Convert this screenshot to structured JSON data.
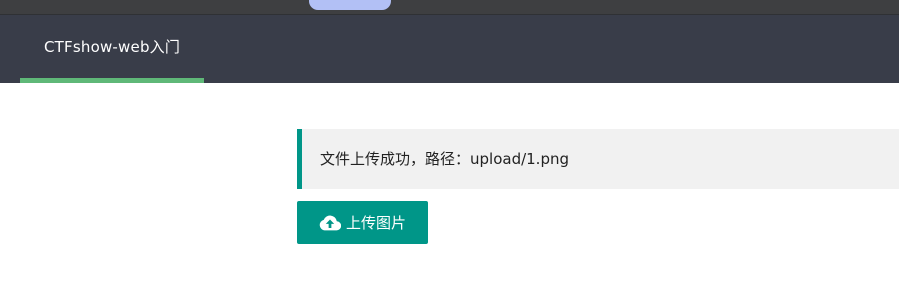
{
  "nav": {
    "tabs": [
      {
        "label": "CTFshow-web入门",
        "active": true
      }
    ]
  },
  "notice": {
    "message": "文件上传成功，路径：upload/1.png"
  },
  "upload": {
    "button_label": "上传图片",
    "icon": "cloud-upload-icon"
  },
  "colors": {
    "nav_bg": "#393d49",
    "active_indicator": "#5fb878",
    "accent": "#009688",
    "notice_bg": "#f1f1f1"
  }
}
